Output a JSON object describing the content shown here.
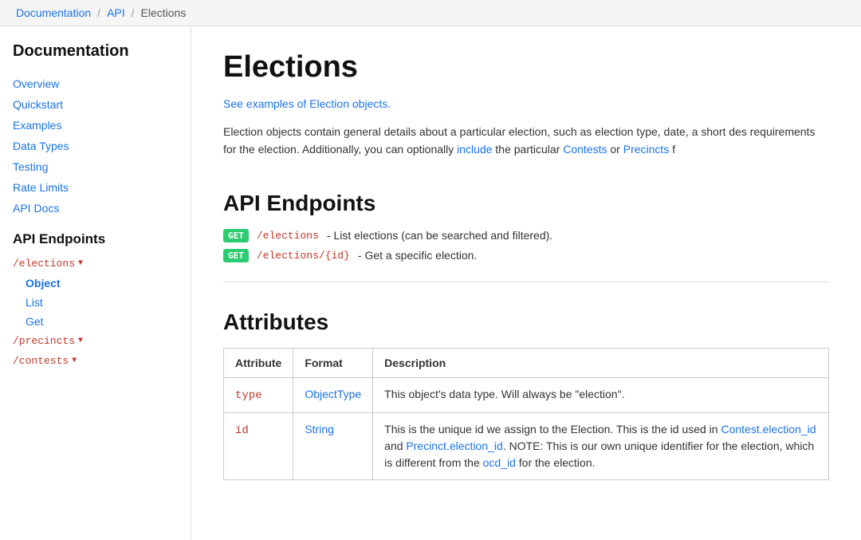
{
  "breadcrumb": {
    "items": [
      {
        "label": "Documentation",
        "href": "#"
      },
      {
        "label": "API",
        "href": "#"
      },
      {
        "label": "Elections",
        "href": "#"
      }
    ]
  },
  "sidebar": {
    "title": "Documentation",
    "nav_items": [
      {
        "label": "Overview",
        "href": "#"
      },
      {
        "label": "Quickstart",
        "href": "#"
      },
      {
        "label": "Examples",
        "href": "#"
      },
      {
        "label": "Data Types",
        "href": "#"
      },
      {
        "label": "Testing",
        "href": "#"
      },
      {
        "label": "Rate Limits",
        "href": "#"
      },
      {
        "label": "API Docs",
        "href": "#"
      }
    ],
    "api_section_title": "API Endpoints",
    "endpoints": [
      {
        "path": "/elections",
        "sub_items": [
          {
            "label": "Object",
            "active": true
          },
          {
            "label": "List",
            "active": false
          },
          {
            "label": "Get",
            "active": false
          }
        ]
      },
      {
        "path": "/precincts",
        "sub_items": []
      },
      {
        "path": "/contests",
        "sub_items": []
      }
    ]
  },
  "main": {
    "page_title": "Elections",
    "see_examples_link": "See examples of Election objects.",
    "description": "Election objects contain general details about a particular election, such as election type, date, a short des requirements for the election. Additionally, you can optionally",
    "description_include_link": "include",
    "description_contests_link": "Contests",
    "description_precincts_link": "Precincts",
    "description_suffix": "f",
    "api_endpoints_title": "API Endpoints",
    "endpoints": [
      {
        "method": "GET",
        "path": "/elections",
        "description": "- List elections (can be searched and filtered)."
      },
      {
        "method": "GET",
        "path": "/elections/{id}",
        "description": "- Get a specific election."
      }
    ],
    "attributes_title": "Attributes",
    "table": {
      "headers": [
        "Attribute",
        "Format",
        "Description"
      ],
      "rows": [
        {
          "attribute": "type",
          "format": "ObjectType",
          "format_link": true,
          "description": "This object's data type. Will always be \"election\"."
        },
        {
          "attribute": "id",
          "format": "String",
          "format_link": true,
          "description_parts": [
            {
              "text": "This is the unique id we assign to the Election. This is the id used in "
            },
            {
              "text": "Contest.election_id",
              "link": true
            },
            {
              "text": " and "
            },
            {
              "text": "Precinct.election_id",
              "link": true
            },
            {
              "text": ". NOTE: This is our own unique identifier for the election, which is different from the "
            },
            {
              "text": "ocd_id",
              "link": true
            },
            {
              "text": " for the election."
            }
          ]
        }
      ]
    }
  }
}
